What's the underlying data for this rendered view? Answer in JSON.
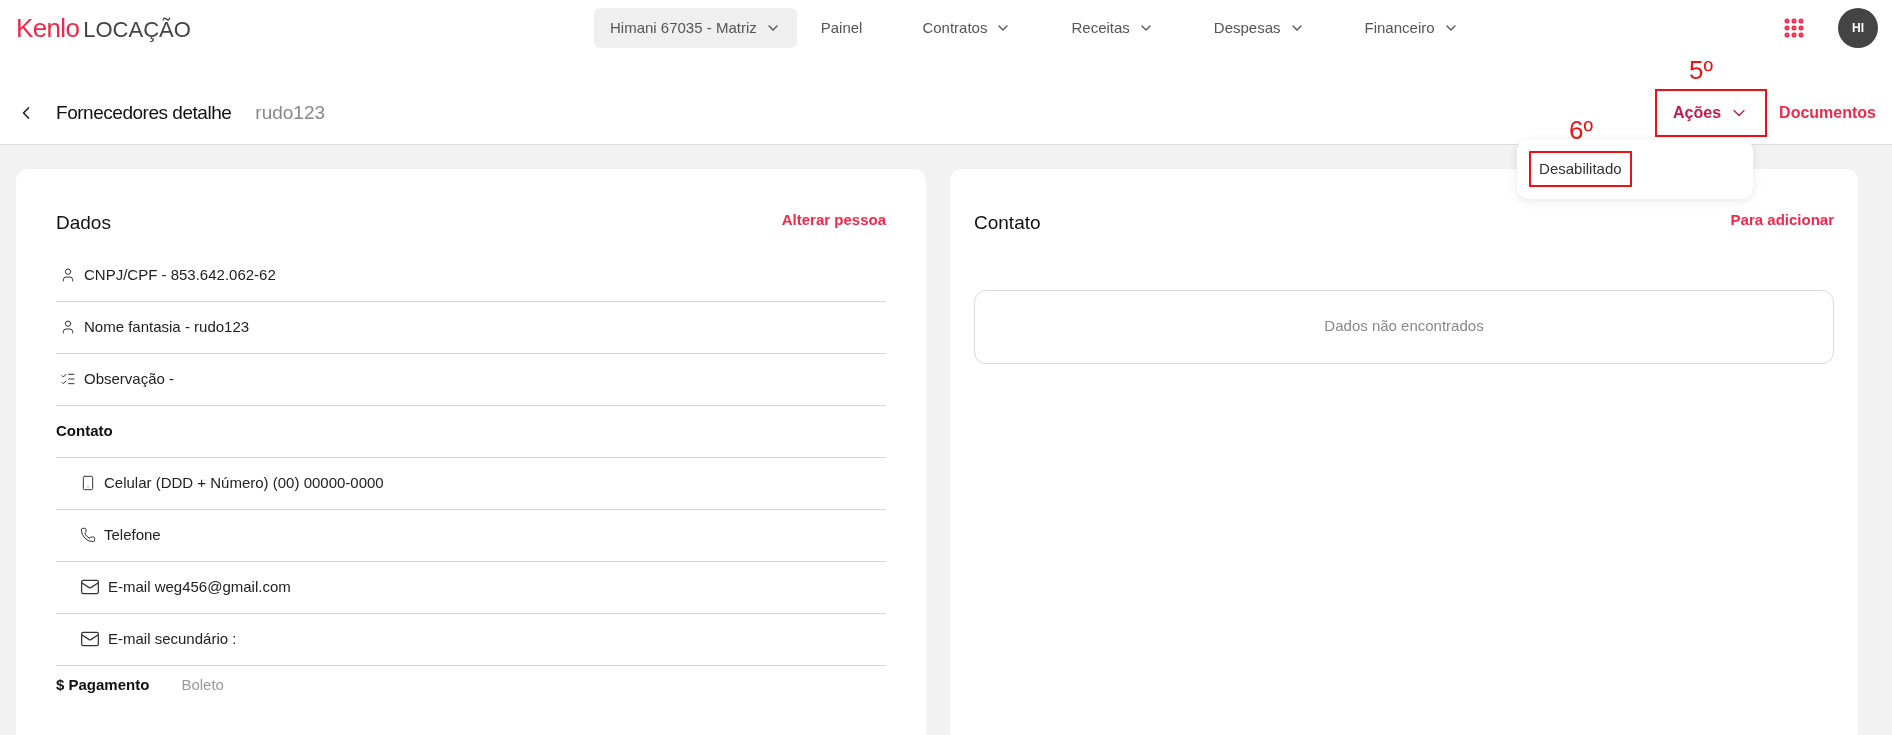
{
  "topbar": {
    "logo": {
      "brand": "Kenlo",
      "product": "LOCAÇÃO"
    },
    "branch_selector": "Himani 67035 - Matriz",
    "nav": [
      {
        "label": "Painel",
        "dropdown": false
      },
      {
        "label": "Contratos",
        "dropdown": true
      },
      {
        "label": "Receitas",
        "dropdown": true
      },
      {
        "label": "Despesas",
        "dropdown": true
      },
      {
        "label": "Financeiro",
        "dropdown": true
      }
    ],
    "avatar": "HI"
  },
  "header": {
    "title": "Fornecedores detalhe",
    "subtitle": "rudo123",
    "actions": {
      "label": "Ações",
      "expanded": true,
      "annotation": "5º",
      "menu": [
        {
          "label": "Desabilitado",
          "annotation": "6º"
        }
      ]
    },
    "documents": "Documentos"
  },
  "data_card": {
    "title": "Dados",
    "link": "Alterar pessoa",
    "rows": [
      {
        "kind": "person",
        "text": "CNPJ/CPF - 853.642.062-62"
      },
      {
        "kind": "person",
        "text": "Nome fantasia - rudo123"
      },
      {
        "kind": "notes",
        "text": "Observação -"
      },
      {
        "kind": "heading",
        "text": "Contato"
      },
      {
        "kind": "mobile",
        "text": "Celular (DDD + Número) (00) 00000-0000"
      },
      {
        "kind": "phone",
        "text": "Telefone"
      },
      {
        "kind": "email",
        "text": "E-mail weg456@gmail.com"
      },
      {
        "kind": "email",
        "text": "E-mail secundário :"
      }
    ],
    "payment": {
      "label": "$ Pagamento",
      "value": "Boleto"
    }
  },
  "contact_card": {
    "title": "Contato",
    "link": "Para adicionar",
    "empty": "Dados não encontrados"
  }
}
